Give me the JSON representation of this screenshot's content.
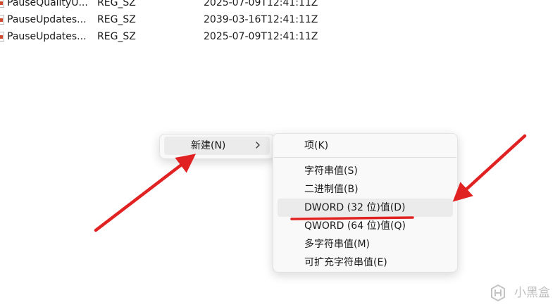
{
  "registry": {
    "rows": [
      {
        "name": "PauseQualityU...",
        "type": "REG_SZ",
        "data": "2025-07-09T12:41:11Z"
      },
      {
        "name": "PauseUpdates...",
        "type": "REG_SZ",
        "data": "2039-03-16T12:41:11Z"
      },
      {
        "name": "PauseUpdates...",
        "type": "REG_SZ",
        "data": "2025-07-09T12:41:11Z"
      }
    ]
  },
  "context_menu": {
    "new_label": "新建(N)"
  },
  "submenu": {
    "key_label": "项(K)",
    "items": [
      {
        "label": "字符串值(S)"
      },
      {
        "label": "二进制值(B)"
      },
      {
        "label": "DWORD (32 位)值(D)"
      },
      {
        "label": "QWORD (64 位)值(Q)"
      },
      {
        "label": "多字符串值(M)"
      },
      {
        "label": "可扩充字符串值(E)"
      }
    ]
  },
  "annotations": {
    "color": "#e02222",
    "highlighted_item": "DWORD (32 位)值(D)"
  },
  "watermark": {
    "text": "小黑盒",
    "icon": "heybox-logo-icon"
  }
}
